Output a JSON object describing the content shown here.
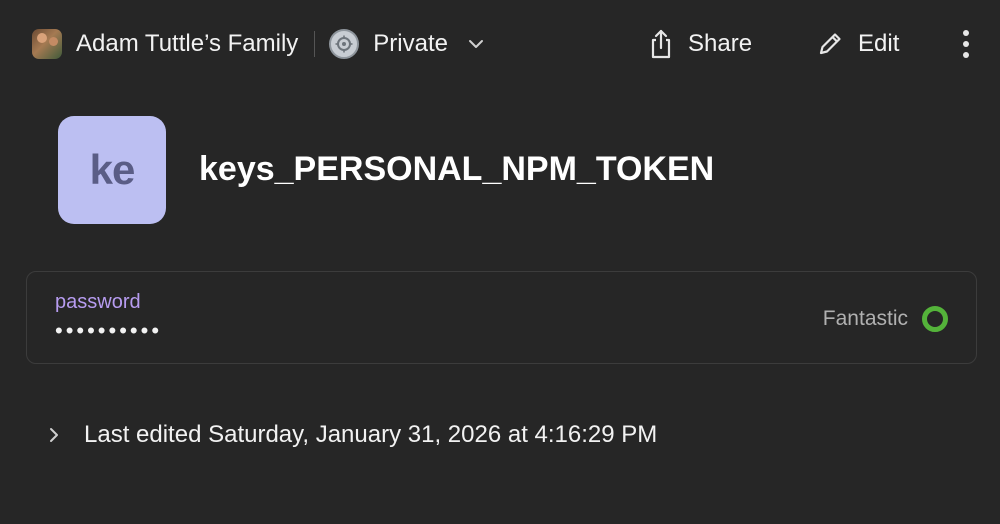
{
  "toolbar": {
    "vault_name": "Adam Tuttle’s Family",
    "privacy_label": "Private",
    "share_label": "Share",
    "edit_label": "Edit"
  },
  "item": {
    "icon_initials": "ke",
    "title": "keys_PERSONAL_NPM_TOKEN"
  },
  "fields": [
    {
      "label": "password",
      "value": "••••••••••",
      "strength": "Fantastic"
    }
  ],
  "history": {
    "label": "Last edited Saturday, January 31, 2026 at 4:16:29 PM"
  },
  "colors": {
    "background": "#262626",
    "field_label": "#b79cf0",
    "icon_background": "#bcbff2",
    "strength_good": "#54b33a"
  },
  "icons": {
    "vault": "vault-avatar-icon",
    "privacy": "vault-lock-icon",
    "privacy_dropdown": "chevron-down-icon",
    "share": "share-icon",
    "edit": "pencil-icon",
    "more": "more-vertical-icon",
    "history_toggle": "chevron-right-icon"
  }
}
